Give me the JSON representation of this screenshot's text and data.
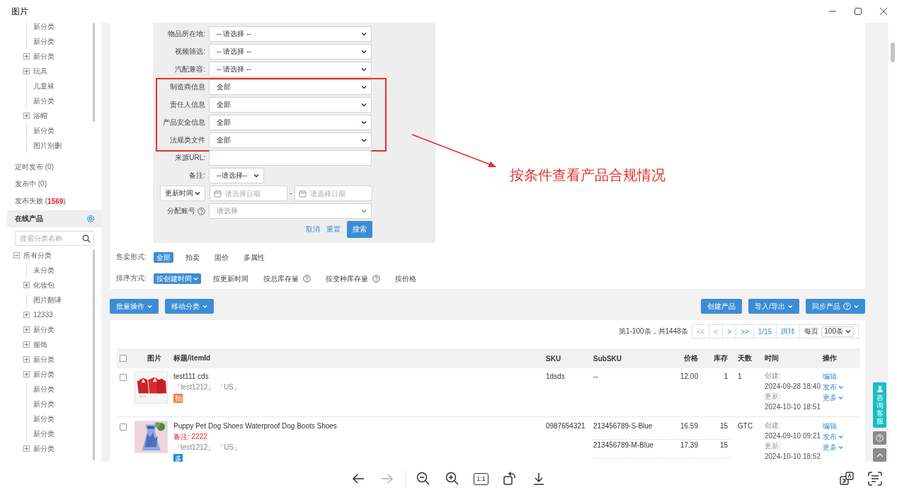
{
  "window": {
    "title": "图片"
  },
  "category_tree": [
    {
      "label": "新分类",
      "expandable": false
    },
    {
      "label": "新分类",
      "expandable": false
    },
    {
      "label": "新分类",
      "expandable": true
    },
    {
      "label": "玩具",
      "expandable": true
    },
    {
      "label": "儿童袜",
      "expandable": false
    },
    {
      "label": "新分类",
      "expandable": false
    },
    {
      "label": "浴帽",
      "expandable": true
    },
    {
      "label": "新分类",
      "expandable": false
    },
    {
      "label": "图片别删",
      "expandable": false
    }
  ],
  "publish_status": [
    {
      "text": "定时发布 (0)"
    },
    {
      "text": "发布中 (0)"
    },
    {
      "text": "发布失败 (**1569**)"
    }
  ],
  "online_products": {
    "title": "在线产品",
    "search": {
      "placeholder": "搜索分类名称"
    },
    "tree": {
      "label": "所有分类",
      "expanded": true,
      "children": [
        {
          "label": "未分类",
          "expandable": false
        },
        {
          "label": "化妆包",
          "expandable": true
        },
        {
          "label": "图片翻译",
          "expandable": false
        },
        {
          "label": "12333",
          "expandable": true
        },
        {
          "label": "新分类",
          "expandable": true
        },
        {
          "label": "服饰",
          "expandable": true
        },
        {
          "label": "新分类",
          "expandable": true
        },
        {
          "label": "新分类",
          "expandable": true
        },
        {
          "label": "新分类",
          "expandable": false
        },
        {
          "label": "新分类",
          "expandable": false
        },
        {
          "label": "新分类",
          "expandable": false
        },
        {
          "label": "新分类",
          "expandable": false
        },
        {
          "label": "新分类",
          "expandable": true
        }
      ]
    }
  },
  "search_form": {
    "fields": [
      {
        "kind": "select",
        "label": "物品所在地:",
        "value": "-- 请选择 --",
        "highlighted": false
      },
      {
        "kind": "select",
        "label": "视频筛选:",
        "value": "-- 请选择 --",
        "highlighted": false
      },
      {
        "kind": "select",
        "label": "汽配兼容:",
        "value": "-- 请选择 --",
        "highlighted": false
      },
      {
        "kind": "select",
        "label": "制造商信息",
        "value": "全部",
        "highlighted": true
      },
      {
        "kind": "select",
        "label": "责任人信息",
        "value": "全部",
        "highlighted": true
      },
      {
        "kind": "select",
        "label": "产品安全信息",
        "value": "全部",
        "highlighted": true
      },
      {
        "kind": "select",
        "label": "法规类文件",
        "value": "全部",
        "highlighted": true
      },
      {
        "kind": "input",
        "label": "来源URL:",
        "highlighted": false
      },
      {
        "kind": "short-select",
        "label": "备注:",
        "value": "--请选择--",
        "highlighted": false
      },
      {
        "kind": "date-range",
        "selector": "更新时间",
        "start_placeholder": "请选择日期",
        "separator": "-",
        "end_placeholder": "请选择日期",
        "highlighted": false
      },
      {
        "kind": "multi-select",
        "label": "分配账号",
        "help": true,
        "placeholder": "请选择",
        "highlighted": false
      }
    ],
    "links": [
      "取消",
      "重置"
    ],
    "submit": "搜索"
  },
  "annotation": "按条件查看产品合规情况",
  "sale_format": {
    "label": "售卖形式:",
    "options": [
      {
        "text": "全部",
        "selected": true
      },
      {
        "text": "拍卖",
        "selected": false
      },
      {
        "text": "固价",
        "selected": false
      },
      {
        "text": "多属性",
        "selected": false
      }
    ]
  },
  "sort": {
    "label": "排序方式:",
    "options": [
      {
        "text": "按创建时间",
        "selected": true,
        "help": false
      },
      {
        "text": "按更新时间",
        "selected": false,
        "help": false
      },
      {
        "text": "按总库存量",
        "selected": false,
        "help": true
      },
      {
        "text": "按变种库存量",
        "selected": false,
        "help": true
      },
      {
        "text": "按价格",
        "selected": false,
        "help": false
      }
    ]
  },
  "actions_left": [
    {
      "text": "批量操作",
      "dropdown": true,
      "help": false
    },
    {
      "text": "移动分类",
      "dropdown": true,
      "help": false
    }
  ],
  "actions_right": [
    {
      "text": "创建产品",
      "dropdown": false,
      "help": false
    },
    {
      "text": "导入/导出",
      "dropdown": true,
      "help": false
    },
    {
      "text": "同步产品",
      "dropdown": true,
      "help": true
    }
  ],
  "pagination": {
    "summary": "第1-100条，共1448条",
    "controls": [
      {
        "text": "<<",
        "disabled": true
      },
      {
        "text": "<",
        "disabled": true
      },
      {
        "text": ">",
        "disabled": false
      },
      {
        "text": ">>",
        "disabled": false
      },
      {
        "text": "1/15",
        "disabled": false
      },
      {
        "text": "跳转",
        "disabled": false
      }
    ],
    "page_size_label": "每页",
    "page_size": "100条"
  },
  "table": {
    "select_all": false,
    "columns": [
      "图片",
      "标题/itemId",
      "SKU",
      "SubSKU",
      "价格",
      "库存",
      "天数",
      "时间",
      "操作"
    ],
    "rows": [
      {
        "checked": false,
        "title": "test111 cds",
        "tags": "「test1212」 「US」",
        "badge": {
          "text": "拍",
          "color": "#f5803e"
        },
        "sku": "1dsds",
        "variants": [
          {
            "subsku": "--",
            "price": "12.00",
            "stock": "1"
          }
        ],
        "days": "1",
        "time": {
          "created_label": "创建:",
          "created": "2024-09-28 18:40",
          "updated_label": "更新:",
          "updated": "2024-10-10 18:51"
        },
        "actions": [
          {
            "text": "编辑",
            "dropdown": false
          },
          {
            "text": "发布",
            "dropdown": true
          },
          {
            "text": "更多",
            "dropdown": true
          }
        ]
      },
      {
        "checked": false,
        "title": "Puppy Pet Dog Shoes Waterproof Dog Boots Shoes",
        "note": "备注: 2222",
        "tags": "「test1212」 「US」",
        "badge": {
          "text": "多",
          "color": "#1e88e5"
        },
        "sku": "0987654321",
        "variants": [
          {
            "subsku": "213456789-S-Blue",
            "price": "16.59",
            "stock": "15"
          },
          {
            "subsku": "213456789-M-Blue",
            "price": "17.39",
            "stock": "15"
          }
        ],
        "days": "GTC",
        "time": {
          "created_label": "创建:",
          "created": "2024-09-10 09:21",
          "updated_label": "更新:",
          "updated": "2024-10-10 18:52"
        },
        "actions": [
          {
            "text": "编辑",
            "dropdown": false
          },
          {
            "text": "发布",
            "dropdown": true
          },
          {
            "text": "更多",
            "dropdown": true
          }
        ]
      }
    ]
  },
  "support": {
    "consult": "咨询客服"
  },
  "viewer_navigation": [
    {
      "kind": "back",
      "disabled": false
    },
    {
      "kind": "forward",
      "disabled": true
    }
  ],
  "viewer_toolbar": [
    {
      "kind": "zoom-out"
    },
    {
      "kind": "zoom-in"
    },
    {
      "kind": "actual-size",
      "text": "1:1"
    },
    {
      "kind": "rotate"
    },
    {
      "kind": "download"
    }
  ],
  "viewer_tools": [
    {
      "kind": "translate"
    },
    {
      "kind": "scan-text"
    }
  ]
}
